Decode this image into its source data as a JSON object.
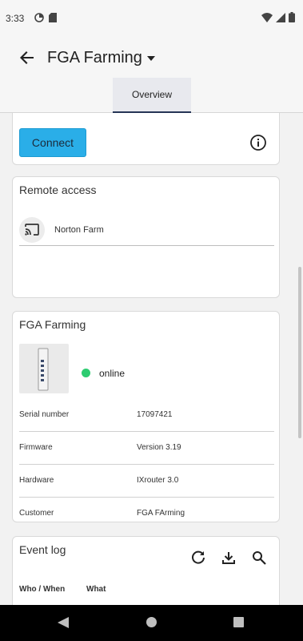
{
  "status_bar": {
    "time": "3:33",
    "icons_left": [
      "data-saver-icon",
      "sd-card-icon"
    ],
    "icons_right": [
      "wifi-icon",
      "signal-icon",
      "battery-icon"
    ]
  },
  "app_bar": {
    "back_icon": "arrow-back-icon",
    "title": "FGA Farming",
    "dropdown_icon": "caret-down-icon"
  },
  "tabs": [
    {
      "label": "Overview",
      "selected": true
    }
  ],
  "connect_card": {
    "button_label": "Connect",
    "info_icon": "info-icon"
  },
  "remote_access": {
    "title": "Remote access",
    "items": [
      {
        "icon": "cast-icon",
        "label": "Norton Farm"
      }
    ]
  },
  "device": {
    "title": "FGA Farming",
    "status": "online",
    "status_color": "#2ecc71",
    "details": [
      {
        "key": "Serial number",
        "value": "17097421"
      },
      {
        "key": "Firmware",
        "value": "Version 3.19"
      },
      {
        "key": "Hardware",
        "value": "IXrouter 3.0"
      },
      {
        "key": "Customer",
        "value": "FGA FArming"
      }
    ]
  },
  "event_log": {
    "title": "Event log",
    "tools": [
      "refresh-icon",
      "download-icon",
      "search-icon"
    ],
    "columns": [
      "Who / When",
      "What"
    ]
  },
  "colors": {
    "accent": "#2aaee8",
    "tab_indicator": "#263556"
  },
  "nav_bar": {
    "buttons": [
      "nav-back-icon",
      "nav-home-icon",
      "nav-recents-icon"
    ]
  }
}
